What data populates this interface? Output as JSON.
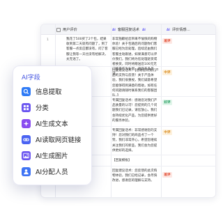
{
  "sheet": {
    "columns": [
      {
        "label": "用户评价",
        "ai": ""
      },
      {
        "label": "客服回复话术",
        "ai": "AI"
      },
      {
        "label": "评价情感…",
        "ai": "AI"
      }
    ],
    "rows": [
      {
        "num": "1",
        "review": "我花了500买了2个包，结果收到第二天就有问题了，到了客服一点反应都没有，问了客服让我等一天也没有给解决，太无语了。",
        "reply": "非常抱歉给您带来不愉快的购物体验！关于包随后的问题你们客服已经为您处理，后续还由我们客服主动跟进，如果满意可以评价我们，我们将为您处理退货或者换货，同时将赠送您100元无门槛券作为补偿，请您多多见谅。",
        "sentiment": "差评",
        "level": "bad"
      },
      {
        "num": "",
        "review": "",
        "reply": "回复建议话术：【感谢您对我们产品的支持与反馈！关于产品体验，我们很重视，我们诚意希望您能够得到满意的帮助，如有任何问题请随时联系我们的客服团队。】",
        "sentiment": "中评",
        "level": "mid"
      },
      {
        "num": "",
        "review": "",
        "reply": "专属回复话术：感谢您对我们产品质量的认可！您提到的几个问题我们已记录，请您放心，我们会持续优化产品，为您提供更好的服务体验。",
        "sentiment": "好评",
        "level": "good"
      },
      {
        "num": "",
        "review": "",
        "reply": "专属回复话术：非常感谢您的支持！您对我们的商品点了一个赞，我们非常开心，希望您继续关注我们的新品，我们会为您提供更好的选择。",
        "sentiment": "中评",
        "level": "mid"
      },
      {
        "num": "",
        "review": "",
        "reply": "【回复模板】",
        "sentiment": "",
        "level": ""
      },
      {
        "num": "",
        "review": "",
        "reply": "回复建议话术：您反馈的此次购物体验，我们已经记录，会尽快改进，感谢您的理解与支持。",
        "sentiment": "差评",
        "level": "bad"
      }
    ]
  },
  "panel": {
    "title": "AI字段",
    "items": [
      {
        "label": "信息提取",
        "icon": "info-extract-icon",
        "color": "#2f7bf6"
      },
      {
        "label": "分类",
        "icon": "category-grid-icon",
        "color": "#6a55f0"
      },
      {
        "label": "AI生成文本",
        "icon": "ai-text-icon",
        "color": "#8a4cf0"
      },
      {
        "label": "AI读取网页链接",
        "icon": "ai-link-icon",
        "color": "#4a63f2"
      },
      {
        "label": "AI生成图片",
        "icon": "ai-image-icon",
        "color": "#6b56f0"
      },
      {
        "label": "AI分配人员",
        "icon": "ai-person-icon",
        "color": "#3f74f4"
      }
    ]
  }
}
